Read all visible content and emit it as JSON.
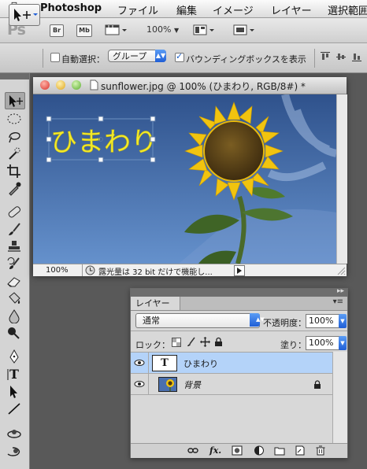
{
  "menubar": {
    "app_name": "Photoshop",
    "items": [
      "ファイル",
      "編集",
      "イメージ",
      "レイヤー",
      "選択範囲"
    ]
  },
  "appbar": {
    "logo": "Ps",
    "bridge": "Br",
    "minibridge": "Mb",
    "zoom": "100%"
  },
  "options": {
    "auto_select_label": "自動選択：",
    "auto_select_target": "グループ",
    "show_bbox_label": "バウンディングボックスを表示"
  },
  "document": {
    "title": "sunflower.jpg @ 100% (ひまわり, RGB/8#) *",
    "text_layer_content": "ひまわり",
    "zoom": "100%",
    "status_message": "露光量は 32 bit だけで機能し..."
  },
  "layers_panel": {
    "tab_label": "レイヤー",
    "blend_mode": "通常",
    "opacity_label": "不透明度：",
    "opacity_value": "100%",
    "lock_label": "ロック：",
    "fill_label": "塗り：",
    "fill_value": "100%",
    "layers": [
      {
        "name": "ひまわり",
        "thumb": "T",
        "selected": true
      },
      {
        "name": "背景",
        "thumb": "",
        "selected": false,
        "locked": true
      }
    ]
  },
  "colors": {
    "selection_blue": "#b4d3f9",
    "text_yellow": "#f2ea2a",
    "sky_top": "#33568f",
    "sky_bottom": "#5f8bc6"
  }
}
